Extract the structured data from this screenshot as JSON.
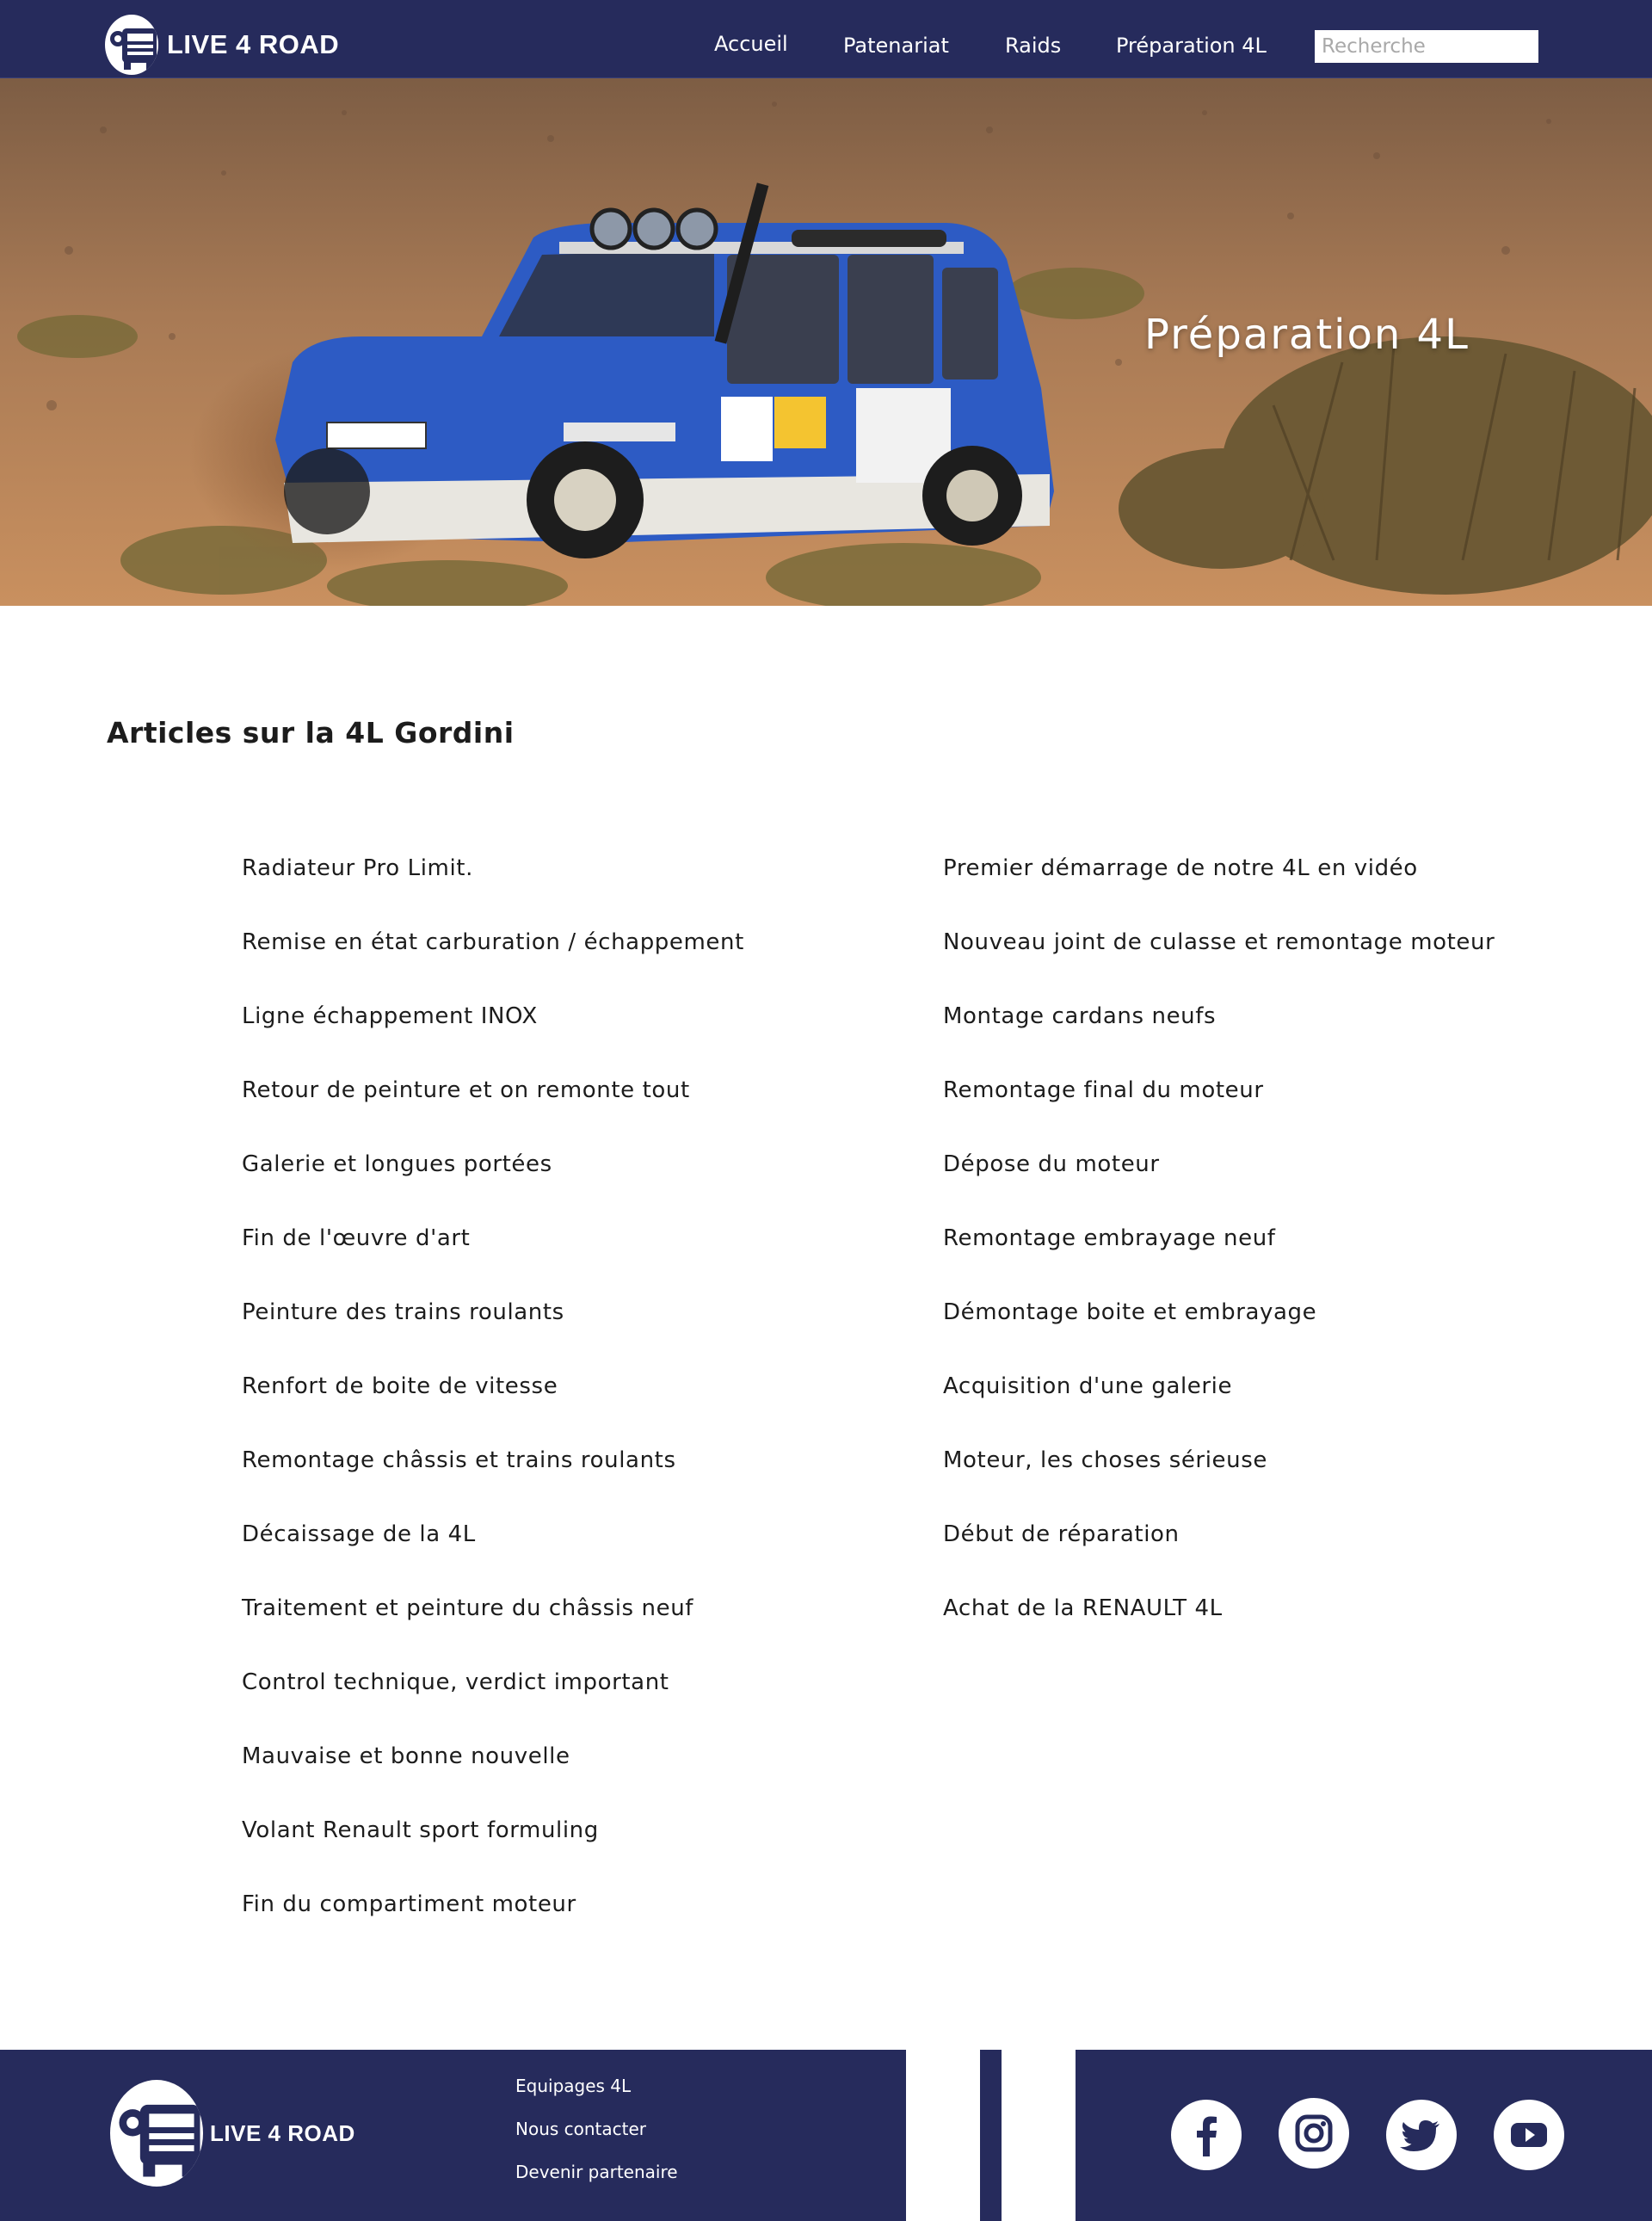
{
  "header": {
    "logo_text": "LIVE 4 ROAD",
    "nav": [
      "Accueil",
      "Patenariat",
      "Raids",
      "Préparation 4L"
    ],
    "search_placeholder": "Recherche"
  },
  "hero": {
    "title": "Préparation 4L"
  },
  "articles": {
    "title": "Articles sur la 4L Gordini",
    "left": [
      "Radiateur Pro Limit.",
      "Remise en état carburation / échappement",
      "Ligne échappement INOX",
      "Retour de peinture et on remonte tout",
      "Galerie et longues portées",
      "Fin de l'œuvre d'art",
      "Peinture des trains roulants",
      "Renfort de boite de vitesse",
      "Remontage châssis et trains roulants",
      "Décaissage de la 4L",
      "Traitement et peinture du châssis neuf",
      "Control technique, verdict important",
      "Mauvaise et bonne nouvelle",
      "Volant Renault sport formuling",
      "Fin du compartiment moteur"
    ],
    "right": [
      "Premier démarrage de notre 4L en vidéo",
      "Nouveau joint de culasse et remontage moteur",
      "Montage cardans neufs",
      "Remontage final du moteur",
      "Dépose du moteur",
      "Remontage embrayage neuf",
      "Démontage boite et embrayage",
      "Acquisition d'une galerie",
      "Moteur, les choses sérieuse",
      "Début de réparation",
      "Achat de la RENAULT 4L"
    ]
  },
  "footer": {
    "logo_text": "LIVE 4 ROAD",
    "links": [
      "Equipages 4L",
      "Nous contacter",
      "Devenir partenaire"
    ],
    "social": [
      "facebook-icon",
      "instagram-icon",
      "twitter-icon",
      "youtube-icon"
    ]
  },
  "colors": {
    "brand_navy": "#262b5c",
    "car_blue": "#2d5bc4"
  }
}
